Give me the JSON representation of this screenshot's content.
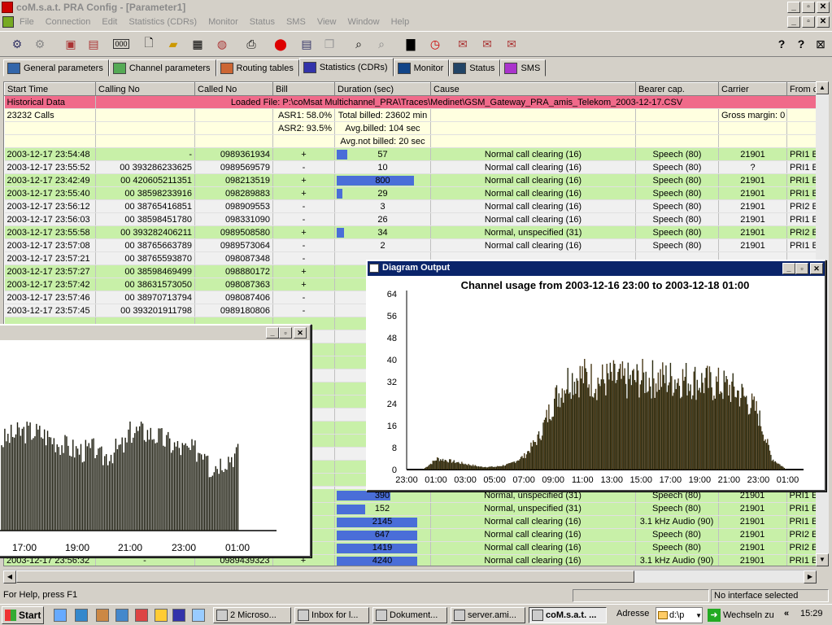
{
  "window": {
    "title": "coM.s.a.t. PRA Config - [Parameter1]"
  },
  "menu": [
    "File",
    "Connection",
    "Edit",
    "Statistics (CDRs)",
    "Monitor",
    "Status",
    "SMS",
    "View",
    "Window",
    "Help"
  ],
  "tabs": [
    {
      "label": "General parameters"
    },
    {
      "label": "Channel parameters"
    },
    {
      "label": "Routing tables"
    },
    {
      "label": "Statistics (CDRs)",
      "active": true
    },
    {
      "label": "Monitor"
    },
    {
      "label": "Status"
    },
    {
      "label": "SMS"
    }
  ],
  "table": {
    "columns": [
      "Start Time",
      "Calling No",
      "Called No",
      "Bill",
      "Duration (sec)",
      "Cause",
      "Bearer cap.",
      "Carrier",
      "From c"
    ],
    "historical": {
      "label": "Historical Data",
      "loaded": "Loaded File: P:\\coMsat Multichannel_PRA\\Traces\\Medinet\\GSM_Gateway_PRA_amis_Telekom_2003-12-17.CSV"
    },
    "summary": {
      "calls": "23232 Calls",
      "asr1": "ASR1: 58.0%",
      "total_billed": "Total billed: 23602 min",
      "gross_margin": "Gross margin: 0",
      "asr2": "ASR2: 93.5%",
      "avg_billed": "Avg.billed: 104 sec",
      "avg_not_billed": "Avg.not billed: 20 sec"
    },
    "rows": [
      {
        "time": "2003-12-17 23:54:48",
        "calling": "-",
        "called": "0989361934",
        "bill": "+",
        "dur": "57",
        "bar": 0.12,
        "cause": "Normal call clearing (16)",
        "bearer": "Speech (80)",
        "carrier": "21901",
        "from": "PRI1 E",
        "color": "g"
      },
      {
        "time": "2003-12-17 23:55:52",
        "calling": "00 393286233625",
        "called": "0989569579",
        "bill": "-",
        "dur": "10",
        "bar": 0,
        "cause": "Normal call clearing (16)",
        "bearer": "Speech (80)",
        "carrier": "?",
        "from": "PRI1 E",
        "color": "w"
      },
      {
        "time": "2003-12-17 23:42:49",
        "calling": "00 420605211351",
        "called": "098213519",
        "bill": "+",
        "dur": "800",
        "bar": 0.86,
        "cause": "Normal call clearing (16)",
        "bearer": "Speech (80)",
        "carrier": "21901",
        "from": "PRI1 E",
        "color": "g"
      },
      {
        "time": "2003-12-17 23:55:40",
        "calling": "00 38598233916",
        "called": "098289883",
        "bill": "+",
        "dur": "29",
        "bar": 0.06,
        "cause": "Normal call clearing (16)",
        "bearer": "Speech (80)",
        "carrier": "21901",
        "from": "PRI1 E",
        "color": "g"
      },
      {
        "time": "2003-12-17 23:56:12",
        "calling": "00 38765416851",
        "called": "098909553",
        "bill": "-",
        "dur": "3",
        "bar": 0,
        "cause": "Normal call clearing (16)",
        "bearer": "Speech (80)",
        "carrier": "21901",
        "from": "PRI2 E",
        "color": "w"
      },
      {
        "time": "2003-12-17 23:56:03",
        "calling": "00 38598451780",
        "called": "098331090",
        "bill": "-",
        "dur": "26",
        "bar": 0,
        "cause": "Normal call clearing (16)",
        "bearer": "Speech (80)",
        "carrier": "21901",
        "from": "PRI1 E",
        "color": "w"
      },
      {
        "time": "2003-12-17 23:55:58",
        "calling": "00 393282406211",
        "called": "0989508580",
        "bill": "+",
        "dur": "34",
        "bar": 0.08,
        "cause": "Normal, unspecified (31)",
        "bearer": "Speech (80)",
        "carrier": "21901",
        "from": "PRI2 E",
        "color": "g"
      },
      {
        "time": "2003-12-17 23:57:08",
        "calling": "00 38765663789",
        "called": "0989573064",
        "bill": "-",
        "dur": "2",
        "bar": 0,
        "cause": "Normal call clearing (16)",
        "bearer": "Speech (80)",
        "carrier": "21901",
        "from": "PRI1 E",
        "color": "w"
      },
      {
        "time": "2003-12-17 23:57:21",
        "calling": "00 38765593870",
        "called": "098087348",
        "bill": "-",
        "dur": "",
        "bar": 0,
        "cause": "",
        "bearer": "",
        "carrier": "",
        "from": "",
        "color": "w"
      },
      {
        "time": "2003-12-17 23:57:27",
        "calling": "00 38598469499",
        "called": "098880172",
        "bill": "+",
        "dur": "",
        "bar": 0,
        "cause": "",
        "bearer": "",
        "carrier": "",
        "from": "",
        "color": "g"
      },
      {
        "time": "2003-12-17 23:57:42",
        "calling": "00 38631573050",
        "called": "098087363",
        "bill": "+",
        "dur": "",
        "bar": 0,
        "cause": "",
        "bearer": "",
        "carrier": "",
        "from": "",
        "color": "g"
      },
      {
        "time": "2003-12-17 23:57:46",
        "calling": "00 38970713794",
        "called": "098087406",
        "bill": "-",
        "dur": "",
        "bar": 0,
        "cause": "",
        "bearer": "",
        "carrier": "",
        "from": "",
        "color": "w"
      },
      {
        "time": "2003-12-17 23:57:45",
        "calling": "00 393201911798",
        "called": "0989180806",
        "bill": "-",
        "dur": "",
        "bar": 0,
        "cause": "",
        "bearer": "",
        "carrier": "",
        "from": "",
        "color": "w"
      }
    ],
    "bottom_rows": [
      {
        "dur": "390",
        "bar": 0.6,
        "cause": "Normal, unspecified (31)",
        "bearer": "Speech (80)",
        "carrier": "21901",
        "from": "PRI1 E",
        "color": "g"
      },
      {
        "dur": "152",
        "bar": 0.32,
        "cause": "Normal, unspecified (31)",
        "bearer": "Speech (80)",
        "carrier": "21901",
        "from": "PRI1 E",
        "color": "g"
      },
      {
        "dur": "2145",
        "bar": 0.9,
        "cause": "Normal call clearing (16)",
        "bearer": "3.1 kHz Audio (90)",
        "carrier": "21901",
        "from": "PRI1 E",
        "color": "g"
      },
      {
        "dur": "647",
        "bar": 0.9,
        "cause": "Normal call clearing (16)",
        "bearer": "Speech (80)",
        "carrier": "21901",
        "from": "PRI2 E",
        "color": "g"
      },
      {
        "dur": "1419",
        "bar": 0.9,
        "cause": "Normal call clearing (16)",
        "bearer": "Speech (80)",
        "carrier": "21901",
        "from": "PRI2 E",
        "color": "g"
      },
      {
        "time": "2003-12-17 23:56:32",
        "calling": "-",
        "called": "0989439323",
        "bill": "+",
        "dur": "4240",
        "bar": 0.9,
        "cause": "Normal call clearing (16)",
        "bearer": "3.1 kHz Audio (90)",
        "carrier": "21901",
        "from": "PRI1 E",
        "color": "g"
      }
    ]
  },
  "diagram": {
    "window_title": "Diagram Output",
    "chart_data": {
      "type": "bar",
      "title": "Channel usage from 2003-12-16 23:00 to 2003-12-18 01:00",
      "xlabel": "",
      "ylabel": "",
      "ylim": [
        0,
        64
      ],
      "yticks": [
        0,
        8,
        16,
        24,
        32,
        40,
        48,
        56,
        64
      ],
      "xticks": [
        "23:00",
        "01:00",
        "03:00",
        "05:00",
        "07:00",
        "09:00",
        "11:00",
        "13:00",
        "15:00",
        "17:00",
        "19:00",
        "21:00",
        "23:00",
        "01:00"
      ],
      "x": [
        "23:00",
        "00:00",
        "01:00",
        "02:00",
        "03:00",
        "04:00",
        "05:00",
        "06:00",
        "07:00",
        "08:00",
        "09:00",
        "10:00",
        "11:00",
        "12:00",
        "13:00",
        "14:00",
        "15:00",
        "16:00",
        "17:00",
        "18:00",
        "19:00",
        "20:00",
        "21:00",
        "22:00",
        "23:00",
        "00:00",
        "01:00"
      ],
      "values": [
        0,
        0,
        4,
        3,
        2,
        1,
        1,
        2,
        5,
        12,
        25,
        33,
        34,
        32,
        33,
        32,
        33,
        33,
        33,
        33,
        32,
        31,
        30,
        27,
        21,
        4,
        0
      ]
    }
  },
  "back_chart": {
    "xticks": [
      "17:00",
      "19:00",
      "21:00",
      "23:00",
      "01:00"
    ]
  },
  "statusbar": {
    "help": "For Help, press F1",
    "interface": "No interface selected"
  },
  "taskbar": {
    "start": "Start",
    "items": [
      "2 Microso...",
      "Inbox for l...",
      "Dokument...",
      "server.ami...",
      "coM.s.a.t. ..."
    ],
    "address_label": "Adresse",
    "address_value": "d:\\p",
    "go_label": "Wechseln zu",
    "clock": "15:29"
  }
}
